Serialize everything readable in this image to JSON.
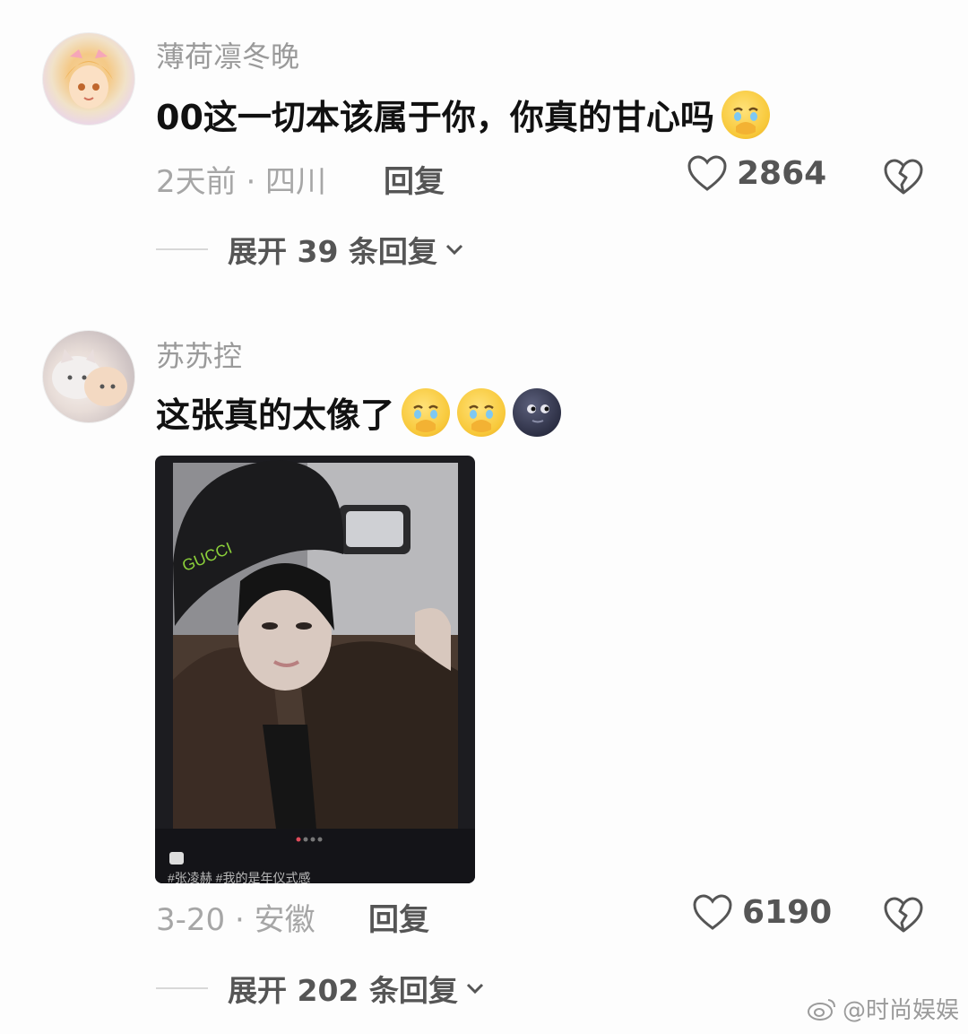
{
  "comments": [
    {
      "username": "薄荷凛冬晚",
      "text": "00这一切本该属于你，你真的甘心吗",
      "emojis": [
        "holding-back-tears"
      ],
      "time_location": "2天前 · 四川",
      "reply_label": "回复",
      "likes": "2864",
      "expand_label": "展开 39 条回复"
    },
    {
      "username": "苏苏控",
      "text": "这张真的太像了",
      "emojis": [
        "holding-back-tears",
        "holding-back-tears",
        "new-moon-face"
      ],
      "image": {
        "hat_text": "GUCCI",
        "caption": "#张凌赫 #我的是年仪式感"
      },
      "time_location": "3-20 · 安徽",
      "reply_label": "回复",
      "likes": "6190",
      "expand_label": "展开 202 条回复"
    }
  ],
  "watermark": "@时尚娱娱",
  "colors": {
    "username": "#9a9a9a",
    "meta": "#a6a6a6",
    "action": "#555555"
  }
}
